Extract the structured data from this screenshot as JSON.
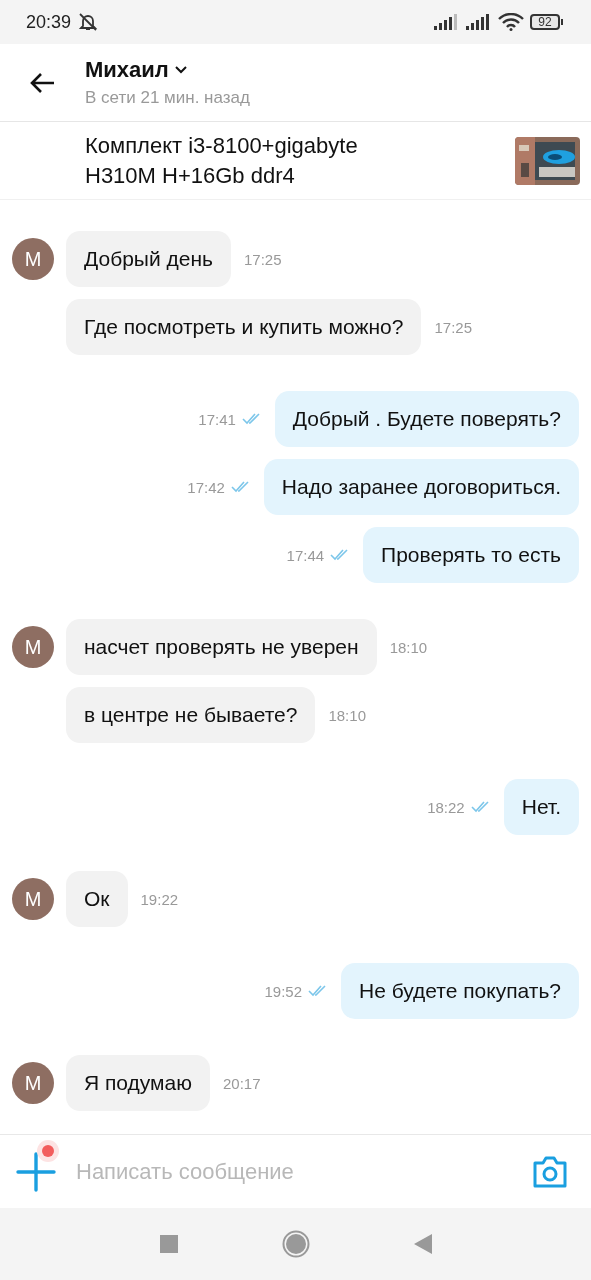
{
  "status_bar": {
    "time": "20:39",
    "battery": "92"
  },
  "header": {
    "name": "Михаил",
    "status": "В сети 21 мин. назад"
  },
  "listing": {
    "title": "Комплект i3-8100+gigabyte H310M H+16Gb ddr4"
  },
  "groups": [
    {
      "kind": "incoming",
      "avatar": "M",
      "messages": [
        {
          "text": "Добрый день",
          "time": "17:25"
        },
        {
          "text": "Где посмотреть и купить можно?",
          "time": "17:25"
        }
      ]
    },
    {
      "kind": "outgoing",
      "messages": [
        {
          "text": "Добрый . Будете поверять?",
          "time": "17:41",
          "read": true
        },
        {
          "text": "Надо заранее договориться.",
          "time": "17:42",
          "read": true
        },
        {
          "text": "Проверять то есть",
          "time": "17:44",
          "read": true
        }
      ]
    },
    {
      "kind": "incoming",
      "avatar": "M",
      "messages": [
        {
          "text": "насчет проверять не уверен",
          "time": "18:10"
        },
        {
          "text": "в центре не бываете?",
          "time": "18:10"
        }
      ]
    },
    {
      "kind": "outgoing",
      "messages": [
        {
          "text": "Нет.",
          "time": "18:22",
          "read": true
        }
      ]
    },
    {
      "kind": "incoming",
      "avatar": "M",
      "messages": [
        {
          "text": "Ок",
          "time": "19:22"
        }
      ]
    },
    {
      "kind": "outgoing",
      "messages": [
        {
          "text": "Не будете покупать?",
          "time": "19:52",
          "read": true
        }
      ]
    },
    {
      "kind": "incoming",
      "avatar": "M",
      "messages": [
        {
          "text": "Я подумаю",
          "time": "20:17"
        }
      ]
    }
  ],
  "composer": {
    "placeholder": "Написать сообщение",
    "attach_badge": true
  }
}
